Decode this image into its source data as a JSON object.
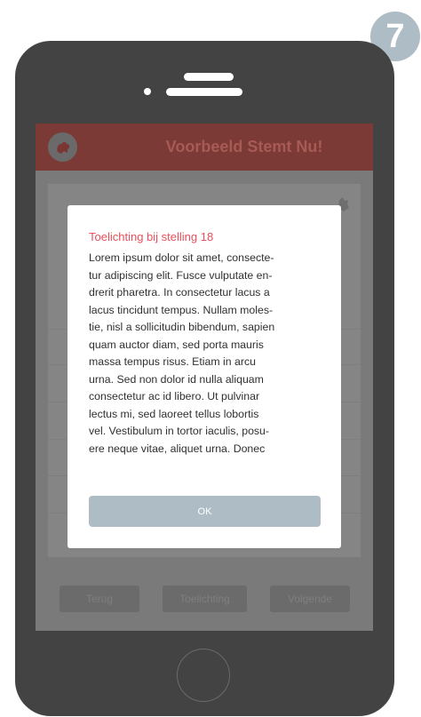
{
  "step": {
    "number": "7"
  },
  "app": {
    "title": "Voorbeeld Stemt Nu!"
  },
  "modal": {
    "title": "Toelichting bij stelling 18",
    "body_lines": [
      "Lorem ipsum dolor sit amet, consecte-",
      "tur adipiscing elit. Fusce vulputate en-",
      "drerit pharetra. In consectetur lacus a",
      "lacus tincidunt tempus. Nullam moles-",
      "tie, nisl a sollicitudin bibendum, sapien",
      "quam auctor diam, sed porta mauris",
      "massa tempus risus. Etiam in arcu",
      "urna. Sed non dolor id nulla aliquam",
      "consectetur ac id libero. Ut pulvinar",
      "lectus mi, sed laoreet tellus lobortis",
      "vel. Vestibulum in tortor iaculis, posu-",
      "ere neque vitae, aliquet urna. Donec"
    ],
    "ok_label": "OK"
  },
  "nav": {
    "back_label": "Terug",
    "explain_label": "Toelichting",
    "next_label": "Volgende"
  },
  "colors": {
    "accent": "#e8505b",
    "button": "#aebcc6",
    "phone": "#434343",
    "header": "#7b3a36"
  },
  "icons": {
    "logo": "logo-icon",
    "card_corner": "corner-icon"
  }
}
